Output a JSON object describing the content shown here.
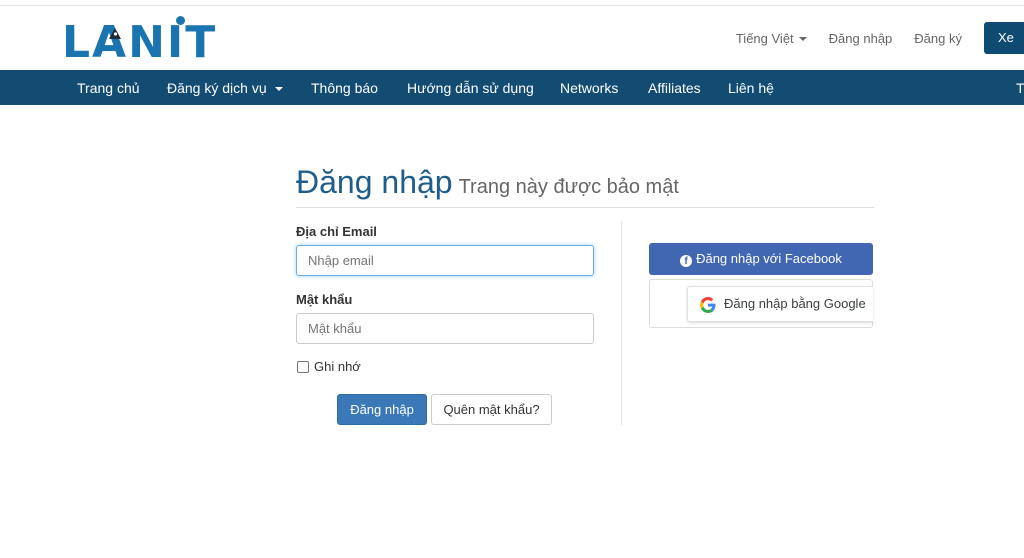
{
  "brand": {
    "logo_text": "LANIT",
    "brand_color": "#1a74b0",
    "nav_color": "#124c73"
  },
  "top_links": {
    "language": "Tiếng Việt",
    "login": "Đăng nhập",
    "register": "Đăng ký",
    "cta": "Xe"
  },
  "nav": {
    "items": [
      {
        "label": "Trang chủ"
      },
      {
        "label": "Đăng ký dịch vụ"
      },
      {
        "label": "Thông báo"
      },
      {
        "label": "Hướng dẫn sử dụng"
      },
      {
        "label": "Networks"
      },
      {
        "label": "Affiliates"
      },
      {
        "label": "Liên hệ"
      }
    ],
    "right_cut": "T"
  },
  "page": {
    "title": "Đăng nhập",
    "subtitle": "Trang này được bảo mật"
  },
  "form": {
    "email_label": "Địa chỉ Email",
    "email_placeholder": "Nhập email",
    "password_label": "Mật khẩu",
    "password_placeholder": "Mật khẩu",
    "remember_label": "Ghi nhớ",
    "submit_label": "Đăng nhập",
    "forgot_label": "Quên mật khẩu?"
  },
  "social": {
    "facebook_label": "Đăng nhập với Facebook",
    "google_label": "Đăng nhập bằng Google"
  }
}
